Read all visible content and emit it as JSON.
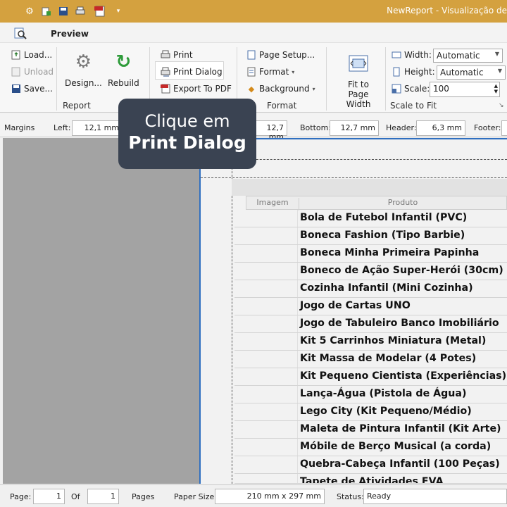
{
  "window": {
    "title": "NewReport - Visualização de"
  },
  "quick_access": [
    "gear-icon",
    "add-icon",
    "save-icon",
    "print-icon",
    "pdf-icon",
    "customize-icon"
  ],
  "ribbon": {
    "tab_preview": "Preview",
    "report_group": {
      "label": "Report",
      "load": "Load...",
      "unload": "Unload",
      "save": "Save...",
      "design": "Design...",
      "rebuild": "Rebuild"
    },
    "print_group": {
      "print": "Print",
      "print_dialog": "Print Dialog",
      "export_pdf": "Export To PDF"
    },
    "format_group": {
      "label": "Format",
      "page_setup": "Page Setup...",
      "format": "Format",
      "background": "Background"
    },
    "fit_group": {
      "fit_line1": "Fit to Page",
      "fit_line2": "Width"
    },
    "scale_group": {
      "label": "Scale to Fit",
      "width_label": "Width:",
      "width_value": "Automatic",
      "height_label": "Height:",
      "height_value": "Automatic",
      "scale_label": "Scale:",
      "scale_value": "100"
    }
  },
  "margins": {
    "label": "Margins",
    "left_label": "Left:",
    "left_value": "12,1 mm",
    "right_value": "12,7 mm",
    "bottom_label": "Bottom:",
    "bottom_value": "12,7 mm",
    "header_label": "Header:",
    "header_value": "6,3 mm",
    "footer_label": "Footer:"
  },
  "table": {
    "col_image": "Imagem",
    "col_product": "Produto",
    "rows": [
      "Bola de Futebol Infantil (PVC)",
      "Boneca Fashion (Tipo Barbie)",
      "Boneca Minha Primeira Papinha",
      "Boneco de Ação Super-Herói (30cm)",
      "Cozinha Infantil (Mini Cozinha)",
      "Jogo de Cartas UNO",
      "Jogo de Tabuleiro Banco Imobiliário",
      "Kit 5 Carrinhos Miniatura (Metal)",
      "Kit Massa de Modelar (4 Potes)",
      "Kit Pequeno Cientista (Experiências)",
      "Lança-Água (Pistola de Água)",
      "Lego City (Kit Pequeno/Médio)",
      "Maleta de Pintura Infantil (Kit Arte)",
      "Móbile de Berço Musical (a corda)",
      "Quebra-Cabeça Infantil (100 Peças)",
      "Tapete de Atividades EVA"
    ]
  },
  "status": {
    "page_label": "Page:",
    "page_value": "1",
    "of_label": "Of",
    "of_value": "1",
    "pages_label": "Pages",
    "paper_label": "Paper Size:",
    "paper_value": "210 mm x 297 mm",
    "status_label": "Status:",
    "status_value": "Ready"
  },
  "tooltip": {
    "line1": "Clique em",
    "line2": "Print Dialog"
  }
}
